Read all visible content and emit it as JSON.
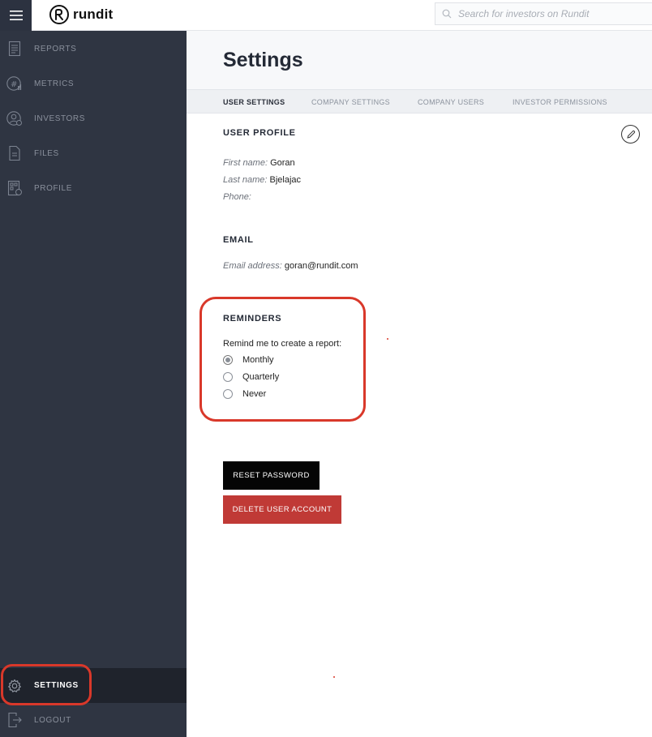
{
  "app": {
    "logo_text": "rundit"
  },
  "search": {
    "placeholder": "Search for investors on Rundit"
  },
  "sidebar": {
    "items": [
      {
        "label": "REPORTS",
        "icon": "report-icon"
      },
      {
        "label": "METRICS",
        "icon": "metrics-icon"
      },
      {
        "label": "INVESTORS",
        "icon": "investors-icon"
      },
      {
        "label": "FILES",
        "icon": "file-icon"
      },
      {
        "label": "PROFILE",
        "icon": "profile-icon"
      }
    ],
    "bottom": [
      {
        "label": "SETTINGS",
        "icon": "gear-icon",
        "active": true
      },
      {
        "label": "LOGOUT",
        "icon": "logout-icon"
      }
    ]
  },
  "page": {
    "title": "Settings"
  },
  "tabs": [
    {
      "label": "USER SETTINGS",
      "active": true
    },
    {
      "label": "COMPANY SETTINGS"
    },
    {
      "label": "COMPANY USERS"
    },
    {
      "label": "INVESTOR PERMISSIONS"
    }
  ],
  "user_profile": {
    "title": "USER PROFILE",
    "first_name_label": "First name:",
    "first_name": "Goran",
    "last_name_label": "Last name:",
    "last_name": "Bjelajac",
    "phone_label": "Phone:",
    "phone": ""
  },
  "email": {
    "title": "EMAIL",
    "address_label": "Email address:",
    "address": "goran@rundit.com"
  },
  "reminders": {
    "title": "REMINDERS",
    "prompt": "Remind me to create a report:",
    "options": [
      {
        "label": "Monthly",
        "checked": true
      },
      {
        "label": "Quarterly",
        "checked": false
      },
      {
        "label": "Never",
        "checked": false
      }
    ]
  },
  "actions": {
    "reset_password": "RESET PASSWORD",
    "delete_account": "DELETE USER ACCOUNT"
  },
  "colors": {
    "sidebar_bg": "#2f3542",
    "active_item_bg": "#1f232c",
    "annotation": "#d9382a",
    "delete_button": "#c03a36",
    "reset_button": "#050505"
  }
}
